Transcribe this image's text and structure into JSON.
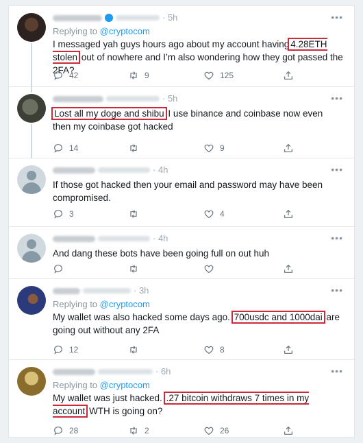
{
  "ui": {
    "more_glyph": "•••",
    "reply_prefix": "Replying to"
  },
  "colors": {
    "mention": "#1d9bf0",
    "highlight_box": "#cc2a3a",
    "verified": "#1d9bf0"
  },
  "tweets": [
    {
      "time": "· 5h",
      "replying_to": "@cryptocom",
      "text_before": "I messaged yah guys hours ago about my account having",
      "highlight": "4.28ETH stolen",
      "text_after": "out of nowhere and I’m also wondering how they got passed the 2FA?",
      "replies": "42",
      "retweets": "9",
      "likes": "125"
    },
    {
      "time": "· 5h",
      "text_before": "",
      "highlight": "Lost all my doge and shibu",
      "text_after": "I use binance and coinbase now even then my coinbase got hacked",
      "replies": "14",
      "retweets": "",
      "likes": "9"
    },
    {
      "time": "· 4h",
      "text": "If those got hacked then your email and password may have been compromised.",
      "replies": "3",
      "retweets": "",
      "likes": "4"
    },
    {
      "time": "· 4h",
      "text": "And dang these bots have been going full on out huh",
      "replies": "",
      "retweets": "",
      "likes": ""
    },
    {
      "time": "· 3h",
      "replying_to": "@cryptocom",
      "text_before": "My wallet was also hacked some days ago.",
      "highlight": "700usdc and 1000dai",
      "text_after": "are going out without any 2FA",
      "replies": "12",
      "retweets": "",
      "likes": "8"
    },
    {
      "time": "· 6h",
      "replying_to": "@cryptocom",
      "text_before": "My wallet was just hacked.",
      "highlight": ".27 bitcoin withdraws 7 times in my account",
      "text_after": "WTH is going on?",
      "replies": "28",
      "retweets": "2",
      "likes": "26"
    }
  ]
}
